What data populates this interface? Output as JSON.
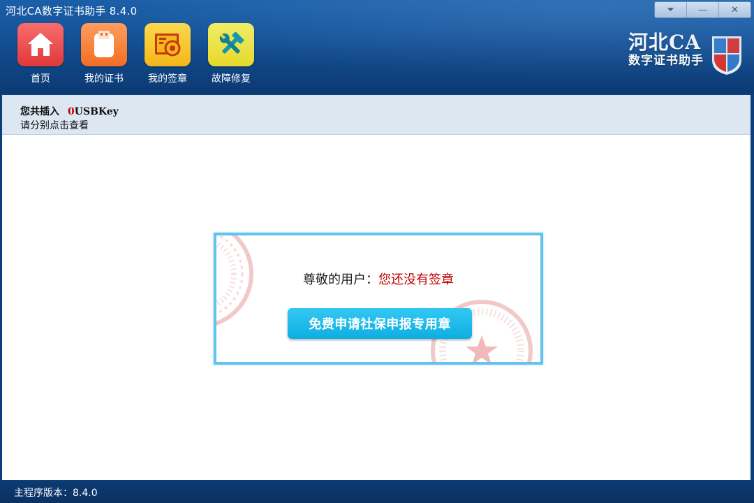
{
  "window": {
    "title": "河北CA数字证书助手  8.4.0",
    "controls": {
      "menu": "⏷",
      "minimize": "—",
      "close": "✕"
    }
  },
  "toolbar": {
    "items": [
      {
        "label": "首页",
        "icon": "home-icon"
      },
      {
        "label": "我的证书",
        "icon": "usb-key-icon"
      },
      {
        "label": "我的签章",
        "icon": "seal-icon"
      },
      {
        "label": "故障修复",
        "icon": "repair-tools-icon"
      }
    ]
  },
  "brand": {
    "title": "河北CA",
    "subtitle": "数字证书助手",
    "logo": "ca-shield-logo"
  },
  "info": {
    "prefix": "您共插入",
    "count": "0",
    "suffix": "USBKey",
    "hint": "请分别点击查看"
  },
  "card": {
    "greeting": "尊敬的用户：",
    "message": "您还没有签章",
    "button_label": "免费申请社保申报专用章"
  },
  "status": {
    "version_text": "主程序版本：8.4.0"
  },
  "colors": {
    "header": "#16559b",
    "accent": "#62c3ee",
    "button": "#1ab8ea",
    "alert_red": "#c00000",
    "info_bg": "#dde7f2"
  }
}
